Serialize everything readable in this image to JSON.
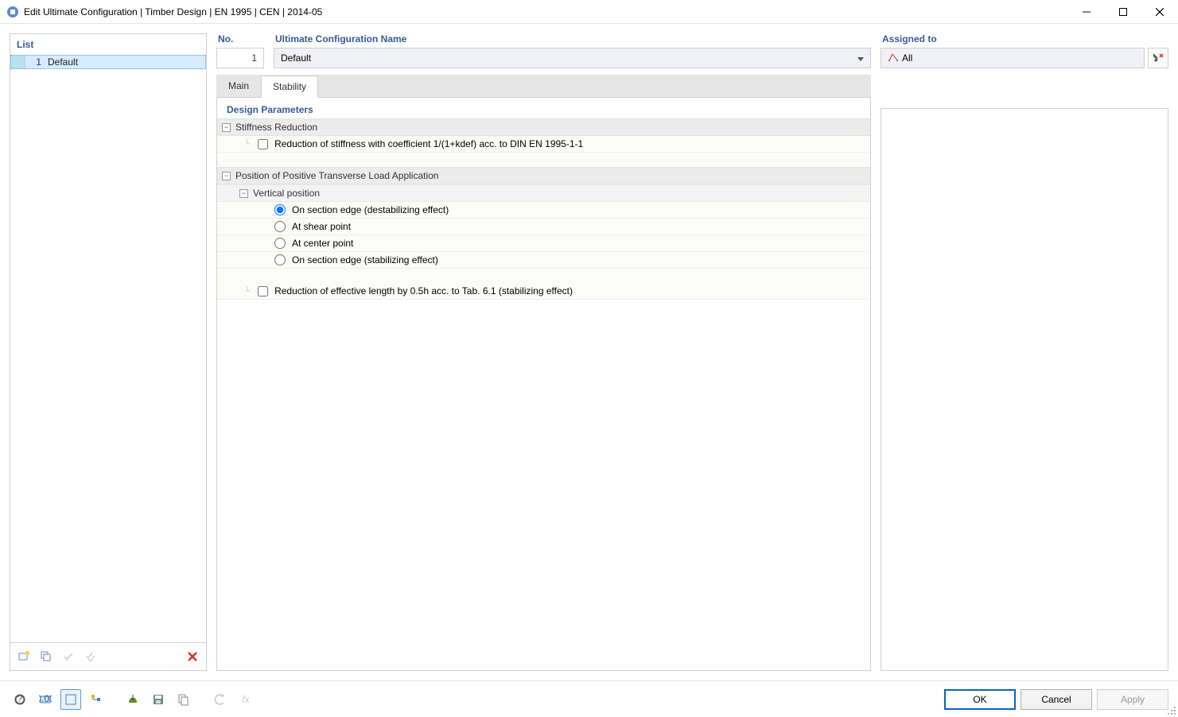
{
  "window": {
    "title": "Edit Ultimate Configuration | Timber Design | EN 1995 | CEN | 2014-05"
  },
  "left": {
    "header": "List",
    "items": [
      {
        "num": "1",
        "label": "Default"
      }
    ]
  },
  "top": {
    "no_label": "No.",
    "no_value": "1",
    "name_label": "Ultimate Configuration Name",
    "name_value": "Default"
  },
  "assigned": {
    "label": "Assigned to",
    "value": "All"
  },
  "tabs": {
    "main": "Main",
    "stability": "Stability"
  },
  "design": {
    "parameters_title": "Design Parameters",
    "groups": {
      "stiffness_reduction": {
        "header": "Stiffness Reduction",
        "reduction_item": "Reduction of stiffness with coefficient 1/(1+kdef) acc. to DIN EN 1995-1-1"
      },
      "positive_load": {
        "header": "Position of Positive Transverse Load Application",
        "vertical_position": "Vertical position",
        "options": {
          "edge_destab": "On section edge (destabilizing effect)",
          "shear": "At shear point",
          "center": "At center point",
          "edge_stab": "On section edge (stabilizing effect)"
        },
        "reduction_eff": "Reduction of effective length by 0.5h acc. to Tab. 6.1 (stabilizing effect)"
      }
    }
  },
  "buttons": {
    "ok": "OK",
    "cancel": "Cancel",
    "apply": "Apply"
  }
}
